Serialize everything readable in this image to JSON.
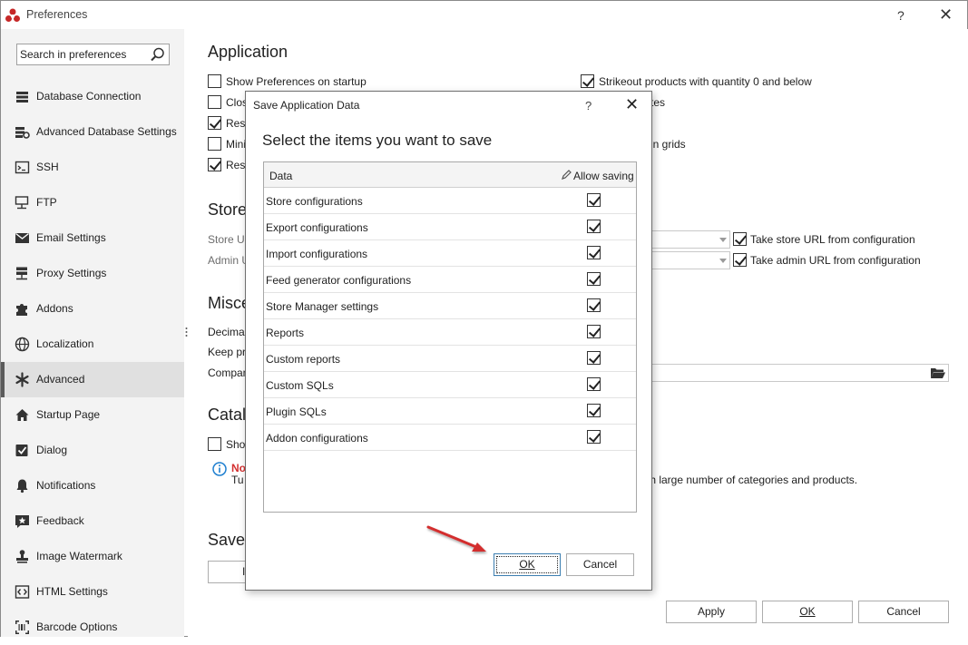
{
  "window": {
    "title": "Preferences",
    "help_glyph": "?",
    "close_glyph": "✕"
  },
  "sidebar": {
    "search_placeholder": "Search in preferences",
    "items": [
      {
        "label": "Database Connection",
        "icon": "database-icon"
      },
      {
        "label": "Advanced Database Settings",
        "icon": "database-settings-icon"
      },
      {
        "label": "SSH",
        "icon": "terminal-icon"
      },
      {
        "label": "FTP",
        "icon": "ftp-icon"
      },
      {
        "label": "Email Settings",
        "icon": "envelope-icon"
      },
      {
        "label": "Proxy Settings",
        "icon": "server-icon"
      },
      {
        "label": "Addons",
        "icon": "puzzle-icon"
      },
      {
        "label": "Localization",
        "icon": "globe-icon"
      },
      {
        "label": "Advanced",
        "icon": "asterisk-icon",
        "active": true
      },
      {
        "label": "Startup Page",
        "icon": "home-icon"
      },
      {
        "label": "Dialog",
        "icon": "checkbox-icon"
      },
      {
        "label": "Notifications",
        "icon": "bell-icon"
      },
      {
        "label": "Feedback",
        "icon": "star-icon"
      },
      {
        "label": "Image Watermark",
        "icon": "stamp-icon"
      },
      {
        "label": "HTML Settings",
        "icon": "code-icon"
      },
      {
        "label": "Barcode Options",
        "icon": "barcode-icon"
      }
    ]
  },
  "main": {
    "application_heading": "Application",
    "app_options": [
      {
        "label": "Show Preferences on startup",
        "checked": false
      },
      {
        "label": "Clos",
        "checked": false
      },
      {
        "label": "Rese",
        "checked": true
      },
      {
        "label": "Mini",
        "checked": false
      },
      {
        "label": "Rest",
        "checked": true
      }
    ],
    "right_options": [
      {
        "label": "Strikeout products with quantity 0 and below",
        "checked": true
      },
      {
        "label": "tes"
      },
      {
        "label": "in grids"
      }
    ],
    "store_heading": "Store",
    "store_url_label": "Store UR",
    "admin_url_label": "Admin U",
    "take_store_url": {
      "label": "Take store URL from configuration",
      "checked": true
    },
    "take_admin_url": {
      "label": "Take admin URL from configuration",
      "checked": true
    },
    "misc_heading": "Misce",
    "misc_labels": [
      "Decimal",
      "Keep pro",
      "Compan"
    ],
    "catalog_heading": "Catal",
    "catalog_show_label": "Show",
    "catalog_checked": false,
    "note_label": "No",
    "note_text_start": "Tu",
    "note_text_end": "th large number of categories and products.",
    "save_heading": "Save/",
    "save_button_fragment": "I",
    "footer": {
      "apply": "Apply",
      "ok": "OK",
      "cancel": "Cancel"
    }
  },
  "dialog": {
    "title": "Save Application Data",
    "help_glyph": "?",
    "close_glyph": "✕",
    "heading": "Select the items you want to save",
    "columns": {
      "data": "Data",
      "allow": "Allow saving"
    },
    "rows": [
      {
        "label": "Store configurations",
        "checked": true
      },
      {
        "label": "Export configurations",
        "checked": true
      },
      {
        "label": "Import configurations",
        "checked": true
      },
      {
        "label": "Feed generator configurations",
        "checked": true
      },
      {
        "label": "Store Manager settings",
        "checked": true
      },
      {
        "label": "Reports",
        "checked": true
      },
      {
        "label": "Custom reports",
        "checked": true
      },
      {
        "label": "Custom SQLs",
        "checked": true
      },
      {
        "label": "Plugin SQLs",
        "checked": true
      },
      {
        "label": "Addon configurations",
        "checked": true
      }
    ],
    "ok": "OK",
    "cancel": "Cancel"
  },
  "colors": {
    "accent_red": "#d32f2f",
    "sidebar_bg": "#f3f3f3",
    "info_blue": "#1e7fd0"
  }
}
